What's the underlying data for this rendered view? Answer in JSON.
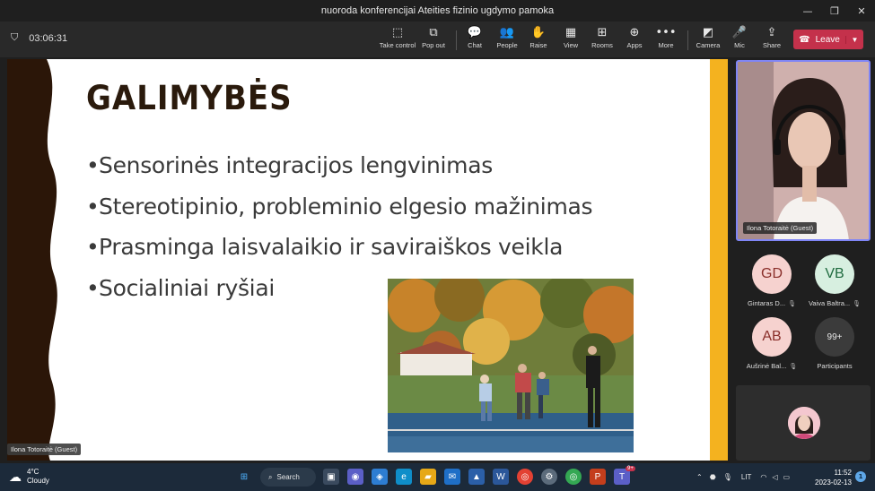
{
  "window": {
    "title": "nuoroda konferencijai Ateities fizinio ugdymo pamoka"
  },
  "meeting": {
    "timer": "03:06:31",
    "toolbar": [
      {
        "label": "Take control",
        "icon": "take-control-icon",
        "glyph": "⬚"
      },
      {
        "label": "Pop out",
        "icon": "pop-out-icon",
        "glyph": "⧉"
      },
      {
        "label": "Chat",
        "icon": "chat-icon",
        "glyph": "💬"
      },
      {
        "label": "People",
        "icon": "people-icon",
        "glyph": "👥"
      },
      {
        "label": "Raise",
        "icon": "raise-hand-icon",
        "glyph": "✋"
      },
      {
        "label": "View",
        "icon": "view-icon",
        "glyph": "▦"
      },
      {
        "label": "Rooms",
        "icon": "rooms-icon",
        "glyph": "⊞"
      },
      {
        "label": "Apps",
        "icon": "apps-icon",
        "glyph": "⊕"
      },
      {
        "label": "More",
        "icon": "more-icon",
        "glyph": "•••"
      },
      {
        "label": "Camera",
        "icon": "camera-off-icon",
        "glyph": "◩"
      },
      {
        "label": "Mic",
        "icon": "mic-off-icon",
        "glyph": "🎤"
      },
      {
        "label": "Share",
        "icon": "share-icon",
        "glyph": "⇪"
      }
    ],
    "leave_label": "Leave"
  },
  "slide": {
    "heading": "GALIMYBĖS",
    "bullets": [
      "Sensorinės integracijos lengvinimas",
      "Stereotipinio, probleminio elgesio mažinimas",
      "Prasminga laisvalaikio ir saviraiškos veikla",
      "Socialiniai ryšiai"
    ],
    "presenter_tag": "Ilona Totoraitė (Guest)"
  },
  "participants": {
    "main_video_name": "Ilona Totoraitė (Guest)",
    "tiles": [
      {
        "initials": "GD",
        "name": "Gintaras D...",
        "bg": "#f6d2cf",
        "fg": "#8a2f2a"
      },
      {
        "initials": "VB",
        "name": "Vaiva Baltra...",
        "bg": "#d7efe0",
        "fg": "#1f6b3f"
      },
      {
        "initials": "AB",
        "name": "Aušrinė Bal...",
        "bg": "#f6d2cf",
        "fg": "#8a2f2a"
      },
      {
        "initials": "99+",
        "name": "Participants",
        "bg": "#3b3b3b",
        "fg": "#e8e8e8"
      }
    ]
  },
  "taskbar": {
    "weather_temp": "4°C",
    "weather_desc": "Cloudy",
    "search_label": "Search",
    "language": "LIT",
    "time": "11:52",
    "date": "2023-02-13",
    "notifications": "1",
    "teams_badge": "9+"
  }
}
